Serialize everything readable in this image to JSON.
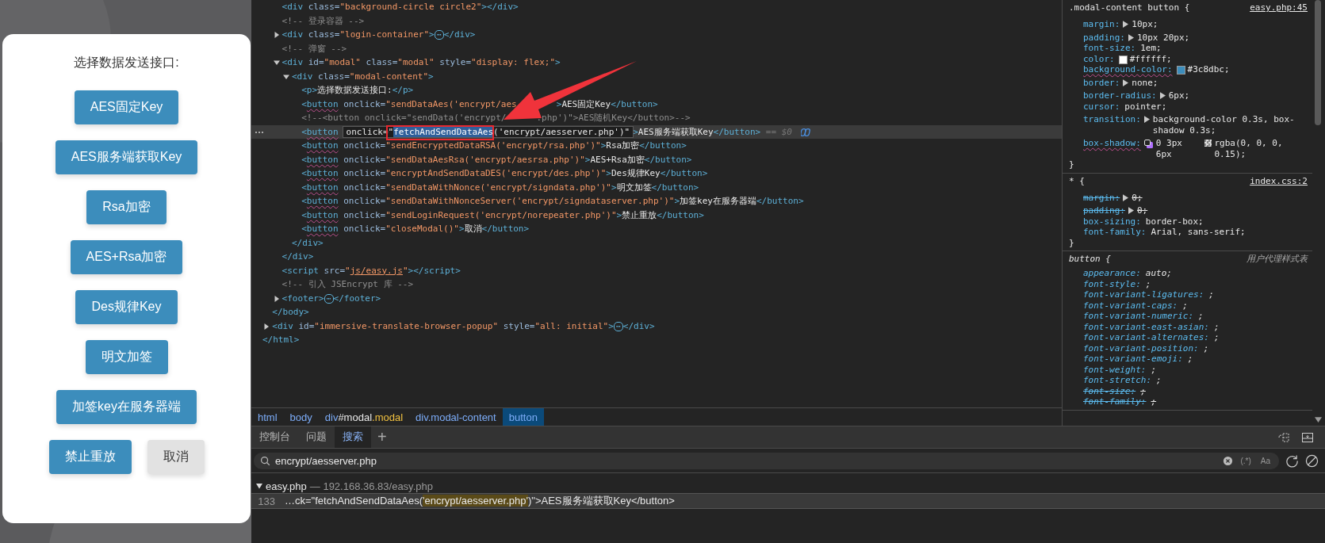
{
  "modal": {
    "title": "选择数据发送接口:",
    "buttons": [
      {
        "label": "AES固定Key",
        "kind": "primary"
      },
      {
        "label": "AES服务端获取Key",
        "kind": "primary"
      },
      {
        "label": "Rsa加密",
        "kind": "primary"
      },
      {
        "label": "AES+Rsa加密",
        "kind": "primary"
      },
      {
        "label": "Des规律Key",
        "kind": "primary"
      },
      {
        "label": "明文加签",
        "kind": "primary"
      },
      {
        "label": "加签key在服务器端",
        "kind": "primary"
      },
      {
        "label": "禁止重放",
        "kind": "primary"
      },
      {
        "label": "取消",
        "kind": "secondary"
      }
    ]
  },
  "dom_tree": [
    {
      "children": [
        {
          "children": [
            {
              "selected": false,
              "tokens": [
                {
                  "kind": "tag",
                  "text": "<div "
                },
                {
                  "kind": "attr",
                  "text": "class"
                },
                {
                  "kind": "eq",
                  "text": "="
                },
                {
                  "kind": "val",
                  "text": "\"background-circle circle2\""
                },
                {
                  "kind": "tag",
                  "text": "></div>"
                }
              ]
            },
            {
              "selected": false,
              "tokens": [
                {
                  "kind": "comment",
                  "text": "<!-- 登录容器 -->"
                }
              ]
            },
            {
              "selected": false,
              "expanded": false,
              "tokens": [
                {
                  "kind": "tag",
                  "text": "<div "
                },
                {
                  "kind": "attr",
                  "text": "class"
                },
                {
                  "kind": "eq",
                  "text": "="
                },
                {
                  "kind": "val",
                  "text": "\"login-container\""
                },
                {
                  "kind": "tag",
                  "text": ">"
                },
                {
                  "kind": "more",
                  "text": "⋯"
                },
                {
                  "kind": "tag",
                  "text": "</div>"
                }
              ]
            },
            {
              "selected": false,
              "tokens": [
                {
                  "kind": "comment",
                  "text": "<!-- 弹窗 -->"
                }
              ]
            },
            {
              "selected": false,
              "expanded": true,
              "tokens": [
                {
                  "kind": "tag",
                  "text": "<div "
                },
                {
                  "kind": "attr",
                  "text": "id"
                },
                {
                  "kind": "eq",
                  "text": "="
                },
                {
                  "kind": "val",
                  "text": "\"modal\" "
                },
                {
                  "kind": "attr",
                  "text": "class"
                },
                {
                  "kind": "eq",
                  "text": "="
                },
                {
                  "kind": "val",
                  "text": "\"modal\" "
                },
                {
                  "kind": "attr",
                  "text": "style"
                },
                {
                  "kind": "eq",
                  "text": "="
                },
                {
                  "kind": "val",
                  "text": "\"display: flex;\""
                },
                {
                  "kind": "tag",
                  "text": ">"
                }
              ],
              "children": [
                {
                  "selected": false,
                  "expanded": true,
                  "tokens": [
                    {
                      "kind": "tag",
                      "text": "<div "
                    },
                    {
                      "kind": "attr",
                      "text": "class"
                    },
                    {
                      "kind": "eq",
                      "text": "="
                    },
                    {
                      "kind": "val",
                      "text": "\"modal-content\""
                    },
                    {
                      "kind": "tag",
                      "text": ">"
                    }
                  ],
                  "children": [
                    {
                      "selected": false,
                      "tokens": [
                        {
                          "kind": "tag",
                          "text": "<p>"
                        },
                        {
                          "kind": "text",
                          "text": "选择数据发送接口:"
                        },
                        {
                          "kind": "tag",
                          "text": "</p>"
                        }
                      ]
                    },
                    {
                      "selected": false,
                      "tokens": [
                        {
                          "kind": "tag",
                          "text": "<"
                        },
                        {
                          "kind": "tag-warn",
                          "text": "button"
                        },
                        {
                          "kind": "attr",
                          "text": " onclick"
                        },
                        {
                          "kind": "eq",
                          "text": "="
                        },
                        {
                          "kind": "val",
                          "text": "\"sendDataAes('encrypt/aes"
                        },
                        {
                          "kind": "tag-after-arrow",
                          "text": ">"
                        },
                        {
                          "kind": "text",
                          "text": "AES固定Key"
                        },
                        {
                          "kind": "tag",
                          "text": "</button>"
                        }
                      ]
                    },
                    {
                      "selected": false,
                      "tokens": [
                        {
                          "kind": "comment",
                          "text": "<!--<button onclick=\"sendData('encrypt/"
                        },
                        {
                          "kind": "comment-after-arrow",
                          "text": ".php')\">AES随机Key</button>-->"
                        }
                      ]
                    },
                    {
                      "selected": true,
                      "tokens": [
                        {
                          "kind": "tag",
                          "text": "<"
                        },
                        {
                          "kind": "tag-warn",
                          "text": "button"
                        },
                        {
                          "kind": "edit",
                          "parts": [
                            {
                              "kind": "plain",
                              "text": "onclick=\""
                            },
                            {
                              "kind": "sel",
                              "text": "fetchAndSendDataAes"
                            },
                            {
                              "kind": "plain",
                              "text": "('encrypt/aesserver.php')\""
                            }
                          ]
                        },
                        {
                          "kind": "tag",
                          "text": ">"
                        },
                        {
                          "kind": "text",
                          "text": "AES服务端获取Key"
                        },
                        {
                          "kind": "tag",
                          "text": "</button>"
                        },
                        {
                          "kind": "dim",
                          "text": " == $0"
                        }
                      ]
                    },
                    {
                      "selected": false,
                      "tokens": [
                        {
                          "kind": "tag",
                          "text": "<"
                        },
                        {
                          "kind": "tag-warn",
                          "text": "button"
                        },
                        {
                          "kind": "attr",
                          "text": " onclick"
                        },
                        {
                          "kind": "eq",
                          "text": "="
                        },
                        {
                          "kind": "val",
                          "text": "\"sendEncryptedDataRSA('encrypt/rsa.php')\""
                        },
                        {
                          "kind": "tag",
                          "text": ">"
                        },
                        {
                          "kind": "text",
                          "text": "Rsa加密"
                        },
                        {
                          "kind": "tag",
                          "text": "</button>"
                        }
                      ]
                    },
                    {
                      "selected": false,
                      "tokens": [
                        {
                          "kind": "tag",
                          "text": "<"
                        },
                        {
                          "kind": "tag-warn",
                          "text": "button"
                        },
                        {
                          "kind": "attr",
                          "text": " onclick"
                        },
                        {
                          "kind": "eq",
                          "text": "="
                        },
                        {
                          "kind": "val",
                          "text": "\"sendDataAesRsa('encrypt/aesrsa.php')\""
                        },
                        {
                          "kind": "tag",
                          "text": ">"
                        },
                        {
                          "kind": "text",
                          "text": "AES+Rsa加密"
                        },
                        {
                          "kind": "tag",
                          "text": "</button>"
                        }
                      ]
                    },
                    {
                      "selected": false,
                      "tokens": [
                        {
                          "kind": "tag",
                          "text": "<"
                        },
                        {
                          "kind": "tag-warn",
                          "text": "button"
                        },
                        {
                          "kind": "attr",
                          "text": " onclick"
                        },
                        {
                          "kind": "eq",
                          "text": "="
                        },
                        {
                          "kind": "val",
                          "text": "\"encryptAndSendDataDES('encrypt/des.php')\""
                        },
                        {
                          "kind": "tag",
                          "text": ">"
                        },
                        {
                          "kind": "text",
                          "text": "Des规律Key"
                        },
                        {
                          "kind": "tag",
                          "text": "</button>"
                        }
                      ]
                    },
                    {
                      "selected": false,
                      "tokens": [
                        {
                          "kind": "tag",
                          "text": "<"
                        },
                        {
                          "kind": "tag-warn",
                          "text": "button"
                        },
                        {
                          "kind": "attr",
                          "text": " onclick"
                        },
                        {
                          "kind": "eq",
                          "text": "="
                        },
                        {
                          "kind": "val",
                          "text": "\"sendDataWithNonce('encrypt/signdata.php')\""
                        },
                        {
                          "kind": "tag",
                          "text": ">"
                        },
                        {
                          "kind": "text",
                          "text": "明文加签"
                        },
                        {
                          "kind": "tag",
                          "text": "</button>"
                        }
                      ]
                    },
                    {
                      "selected": false,
                      "tokens": [
                        {
                          "kind": "tag",
                          "text": "<"
                        },
                        {
                          "kind": "tag-warn",
                          "text": "button"
                        },
                        {
                          "kind": "attr",
                          "text": " onclick"
                        },
                        {
                          "kind": "eq",
                          "text": "="
                        },
                        {
                          "kind": "val",
                          "text": "\"sendDataWithNonceServer('encrypt/signdataserver.php')\""
                        },
                        {
                          "kind": "tag",
                          "text": ">"
                        },
                        {
                          "kind": "text",
                          "text": "加签key在服务器端"
                        },
                        {
                          "kind": "tag",
                          "text": "</button>"
                        }
                      ]
                    },
                    {
                      "selected": false,
                      "tokens": [
                        {
                          "kind": "tag",
                          "text": "<"
                        },
                        {
                          "kind": "tag-warn",
                          "text": "button"
                        },
                        {
                          "kind": "attr",
                          "text": " onclick"
                        },
                        {
                          "kind": "eq",
                          "text": "="
                        },
                        {
                          "kind": "val",
                          "text": "\"sendLoginRequest('encrypt/norepeater.php')\""
                        },
                        {
                          "kind": "tag",
                          "text": ">"
                        },
                        {
                          "kind": "text",
                          "text": "禁止重放"
                        },
                        {
                          "kind": "tag",
                          "text": "</button>"
                        }
                      ]
                    },
                    {
                      "selected": false,
                      "tokens": [
                        {
                          "kind": "tag",
                          "text": "<"
                        },
                        {
                          "kind": "tag-warn",
                          "text": "button"
                        },
                        {
                          "kind": "attr",
                          "text": " onclick"
                        },
                        {
                          "kind": "eq",
                          "text": "="
                        },
                        {
                          "kind": "val",
                          "text": "\"closeModal()\""
                        },
                        {
                          "kind": "tag",
                          "text": ">"
                        },
                        {
                          "kind": "text",
                          "text": "取消"
                        },
                        {
                          "kind": "tag",
                          "text": "</button>"
                        }
                      ]
                    }
                  ]
                },
                {
                  "selected": false,
                  "tokens": [
                    {
                      "kind": "tag",
                      "text": "</div>"
                    }
                  ]
                }
              ]
            },
            {
              "selected": false,
              "tokens": [
                {
                  "kind": "tag",
                  "text": "</div>"
                }
              ]
            },
            {
              "selected": false,
              "tokens": [
                {
                  "kind": "tag",
                  "text": "<script "
                },
                {
                  "kind": "attr",
                  "text": "src"
                },
                {
                  "kind": "eq",
                  "text": "="
                },
                {
                  "kind": "val",
                  "text": "\""
                },
                {
                  "kind": "link",
                  "text": "js/easy.js"
                },
                {
                  "kind": "val",
                  "text": "\""
                },
                {
                  "kind": "tag",
                  "text": "></script>"
                }
              ]
            },
            {
              "selected": false,
              "tokens": [
                {
                  "kind": "comment",
                  "text": "<!-- 引入 JSEncrypt 库 -->"
                }
              ]
            },
            {
              "selected": false,
              "expanded": false,
              "tokens": [
                {
                  "kind": "tag",
                  "text": "<footer>"
                },
                {
                  "kind": "more",
                  "text": "⋯"
                },
                {
                  "kind": "tag",
                  "text": "</footer>"
                }
              ]
            }
          ]
        },
        {
          "selected": false,
          "tokens": [
            {
              "kind": "tag",
              "text": "</body>"
            }
          ]
        },
        {
          "selected": false,
          "expanded": false,
          "tokens": [
            {
              "kind": "tag",
              "text": "<div "
            },
            {
              "kind": "attr",
              "text": "id"
            },
            {
              "kind": "eq",
              "text": "="
            },
            {
              "kind": "val",
              "text": "\"immersive-translate-browser-popup\" "
            },
            {
              "kind": "attr",
              "text": "style"
            },
            {
              "kind": "eq",
              "text": "="
            },
            {
              "kind": "val",
              "text": "\"all: initial\""
            },
            {
              "kind": "tag",
              "text": ">"
            },
            {
              "kind": "more",
              "text": "⋯"
            },
            {
              "kind": "tag",
              "text": "</div>"
            }
          ]
        }
      ]
    },
    {
      "selected": false,
      "tokens": [
        {
          "kind": "tag",
          "text": "</html>"
        }
      ]
    }
  ],
  "styles": [
    {
      "selector": ".modal-content button {",
      "source": "easy.php:45",
      "kind": "file",
      "close": "}",
      "props": [
        {
          "name": "margin:",
          "value": "10px;",
          "kind": "expander",
          "struck": false,
          "warn": false
        },
        {
          "name": "padding:",
          "value": "10px 20px;",
          "kind": "expander",
          "struck": false,
          "warn": false
        },
        {
          "name": "font-size:",
          "value": "1em;",
          "struck": false,
          "warn": false
        },
        {
          "name": "color:",
          "value": "#ffffff;",
          "kind": "swatch",
          "color": "#ffffff",
          "struck": false,
          "warn": false
        },
        {
          "name": "background-color:",
          "value": "#3c8dbc;",
          "kind": "swatch",
          "color": "#3c8dbc",
          "struck": false,
          "warn": true
        },
        {
          "name": "border:",
          "value": "none;",
          "kind": "expander",
          "struck": false,
          "warn": false
        },
        {
          "name": "border-radius:",
          "value": "6px;",
          "kind": "expander",
          "struck": false,
          "warn": false
        },
        {
          "name": "cursor:",
          "value": "pointer;",
          "struck": false,
          "warn": false
        },
        {
          "name": "transition:",
          "value": "background-color 0.3s, box-shadow 0.3s;",
          "kind": "expander",
          "struck": false,
          "warn": false
        },
        {
          "name": "box-shadow:",
          "value": "0 3px 6px",
          "kind": "shadow",
          "value2": "rgba(0, 0, 0, 0.15);",
          "struck": false,
          "warn": true
        }
      ]
    },
    {
      "selector": "* {",
      "source": "index.css:2",
      "kind": "file",
      "close": "}",
      "props": [
        {
          "name": "margin:",
          "value": "0;",
          "kind": "expander",
          "struck": true,
          "warn": false
        },
        {
          "name": "padding:",
          "value": "0;",
          "kind": "expander",
          "struck": true,
          "warn": false
        },
        {
          "name": "box-sizing:",
          "value": "border-box;",
          "struck": false,
          "warn": false
        },
        {
          "name": "font-family:",
          "value": "Arial, sans-serif;",
          "struck": false,
          "warn": false
        }
      ]
    },
    {
      "selector": "button {",
      "source": "用户代理样式表",
      "kind": "user-agent",
      "props": [
        {
          "name": "appearance:",
          "value": "auto;",
          "struck": false,
          "warn": false
        },
        {
          "name": "font-style:",
          "value": ";",
          "struck": false,
          "warn": false
        },
        {
          "name": "font-variant-ligatures:",
          "value": ";",
          "struck": false,
          "warn": false
        },
        {
          "name": "font-variant-caps:",
          "value": ";",
          "struck": false,
          "warn": false
        },
        {
          "name": "font-variant-numeric:",
          "value": ";",
          "struck": false,
          "warn": false
        },
        {
          "name": "font-variant-east-asian:",
          "value": ";",
          "struck": false,
          "warn": false
        },
        {
          "name": "font-variant-alternates:",
          "value": ";",
          "struck": false,
          "warn": false
        },
        {
          "name": "font-variant-position:",
          "value": ";",
          "struck": false,
          "warn": false
        },
        {
          "name": "font-variant-emoji:",
          "value": ";",
          "struck": false,
          "warn": false
        },
        {
          "name": "font-weight:",
          "value": ";",
          "struck": false,
          "warn": false
        },
        {
          "name": "font-stretch:",
          "value": ";",
          "struck": false,
          "warn": false
        },
        {
          "name": "font-size:",
          "value": ";",
          "struck": true,
          "warn": false
        },
        {
          "name": "font-family:",
          "value": ";",
          "struck": true,
          "warn": false
        }
      ]
    }
  ],
  "breadcrumb": [
    {
      "label": "html",
      "selected": false
    },
    {
      "label": "body",
      "selected": false
    },
    {
      "label": "div",
      "id": "#modal",
      "cls": ".modal",
      "selected": false
    },
    {
      "label": "div.modal-content",
      "selected": false
    },
    {
      "label": "button",
      "selected": true
    }
  ],
  "drawer": {
    "tabs": [
      {
        "label": "控制台",
        "selected": false
      },
      {
        "label": "问题",
        "selected": false
      },
      {
        "label": "搜索",
        "selected": true
      }
    ],
    "add": "+",
    "search": {
      "value": "encrypt/aesserver.php",
      "toggles": [
        {
          "label": "(.*)",
          "on": false
        },
        {
          "label": "Aa",
          "on": false
        }
      ]
    },
    "results": [
      {
        "file": "easy.php",
        "path": "— 192.168.36.83/easy.php",
        "expanded": true,
        "matches": [
          {
            "line": "133",
            "before": "…ck=\"fetchAndSendDataAes(",
            "match": "'encrypt/aesserver.php'",
            "after": ")\">AES服务端获取Key</button>",
            "selected": true
          }
        ]
      }
    ]
  }
}
